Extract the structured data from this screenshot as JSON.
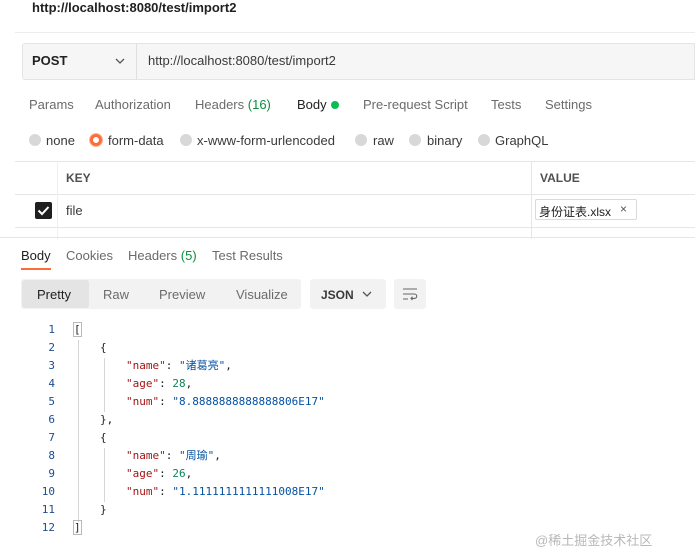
{
  "request": {
    "title": "http://localhost:8080/test/import2",
    "method": "POST",
    "url": "http://localhost:8080/test/import2"
  },
  "request_tabs": {
    "params": "Params",
    "authorization": "Authorization",
    "headers": "Headers",
    "headers_count": "(16)",
    "body": "Body",
    "prerequest": "Pre-request Script",
    "tests": "Tests",
    "settings": "Settings"
  },
  "body_types": {
    "none": "none",
    "form_data": "form-data",
    "urlencoded": "x-www-form-urlencoded",
    "raw": "raw",
    "binary": "binary",
    "graphql": "GraphQL",
    "selected": "form-data"
  },
  "form_table": {
    "key_header": "KEY",
    "value_header": "VALUE",
    "row_key": "file",
    "row_file": "身份证表.xlsx",
    "remove_glyph": "×"
  },
  "response_tabs": {
    "body": "Body",
    "cookies": "Cookies",
    "headers": "Headers",
    "headers_count": "(5)",
    "test_results": "Test Results"
  },
  "view_modes": {
    "pretty": "Pretty",
    "raw": "Raw",
    "preview": "Preview",
    "visualize": "Visualize",
    "format": "JSON"
  },
  "code": {
    "line_numbers": [
      "1",
      "2",
      "3",
      "4",
      "5",
      "6",
      "7",
      "8",
      "9",
      "10",
      "11",
      "12"
    ],
    "open_array": "[",
    "close_array": "]",
    "open_obj": "{",
    "close_obj_comma": "},",
    "close_obj": "}",
    "k_name": "\"name\"",
    "k_age": "\"age\"",
    "k_num": "\"num\"",
    "colon": ": ",
    "comma": ",",
    "name1": "\"诸葛亮\"",
    "age1": "28",
    "num1": "\"8.8888888888888806E17\"",
    "name2": "\"周瑜\"",
    "age2": "26",
    "num2": "\"1.1111111111111008E17\""
  },
  "watermark": "@稀土掘金技术社区",
  "colors": {
    "accent": "#ff6c37",
    "active_dot": "#0cbb52",
    "count_green": "#0b8e3e"
  }
}
